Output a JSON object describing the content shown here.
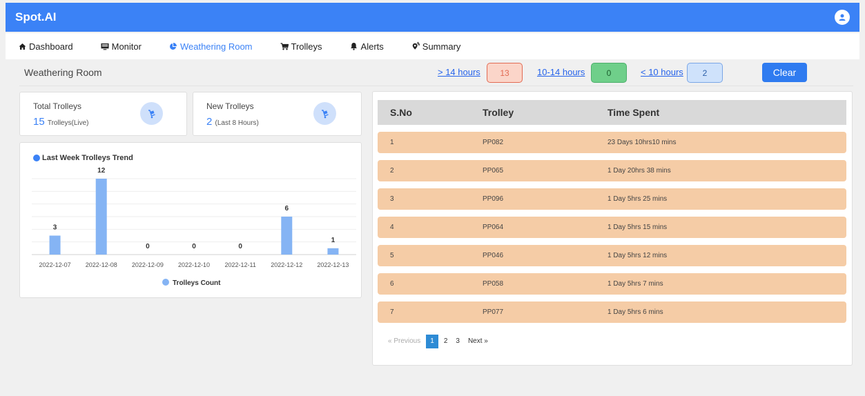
{
  "app": {
    "brand": "Spot.AI"
  },
  "nav": [
    {
      "label": "Dashboard",
      "icon": "home-icon",
      "active": false
    },
    {
      "label": "Monitor",
      "icon": "monitor-icon",
      "active": false
    },
    {
      "label": "Weathering Room",
      "icon": "pie-chart-icon",
      "active": true
    },
    {
      "label": "Trolleys",
      "icon": "trolley-icon",
      "active": false
    },
    {
      "label": "Alerts",
      "icon": "bell-icon",
      "active": false
    },
    {
      "label": "Summary",
      "icon": "location-icon",
      "active": false
    }
  ],
  "page": {
    "title": "Weathering Room"
  },
  "filters": [
    {
      "label": "> 14 hours",
      "count": "13"
    },
    {
      "label": "10-14 hours",
      "count": "0"
    },
    {
      "label": "< 10 hours",
      "count": "2"
    }
  ],
  "clear_label": "Clear",
  "stats": {
    "total": {
      "title": "Total Trolleys",
      "value": "15",
      "unit": "Trolleys(Live)"
    },
    "new": {
      "title": "New Trolleys",
      "value": "2",
      "unit": "(Last 8 Hours)"
    }
  },
  "chart_data": {
    "type": "bar",
    "title": "Last Week Trolleys Trend",
    "categories": [
      "2022-12-07",
      "2022-12-08",
      "2022-12-09",
      "2022-12-10",
      "2022-12-11",
      "2022-12-12",
      "2022-12-13"
    ],
    "series": [
      {
        "name": "Trolleys Count",
        "values": [
          3,
          12,
          0,
          0,
          0,
          6,
          1
        ]
      }
    ],
    "ylim": [
      0,
      12
    ],
    "grid": true,
    "legend": "bottom",
    "color": "#85b4f4"
  },
  "table": {
    "headers": [
      "S.No",
      "Trolley",
      "Time Spent"
    ],
    "rows": [
      [
        "1",
        "PP082",
        "23 Days 10hrs10 mins"
      ],
      [
        "2",
        "PP065",
        "1 Day 20hrs 38 mins"
      ],
      [
        "3",
        "PP096",
        "1 Day 5hrs 25 mins"
      ],
      [
        "4",
        "PP064",
        "1 Day 5hrs 15 mins"
      ],
      [
        "5",
        "PP046",
        "1 Day 5hrs 12 mins"
      ],
      [
        "6",
        "PP058",
        "1 Day 5hrs 7 mins"
      ],
      [
        "7",
        "PP077",
        "1 Day 5hrs 6 mins"
      ]
    ]
  },
  "pagination": {
    "previous": "« Previous",
    "pages": [
      "1",
      "2",
      "3"
    ],
    "current": "1",
    "next": "Next »"
  }
}
